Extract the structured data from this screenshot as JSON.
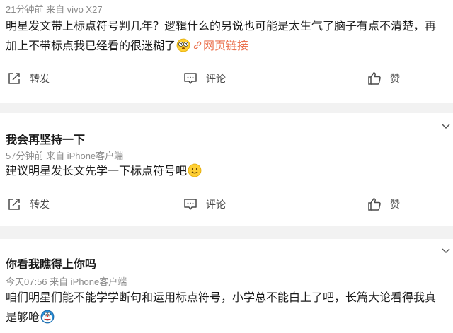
{
  "posts": [
    {
      "meta": "21分钟前  来自 vivo X27",
      "body_line1": "明星发文带上标点符号判几年？逻辑什么的另说也可能是太生气了脑子有点不清楚，再",
      "body_line2": "加上不带标点我已经看的很迷糊了",
      "link_text": "网页链接",
      "actions": {
        "repost": "转发",
        "comment": "评论",
        "like": "赞"
      }
    },
    {
      "user": "我会再坚持一下",
      "meta": "57分钟前  来自 iPhone客户端",
      "body_line1": "建议明星发长文先学一下标点符号吧",
      "actions": {
        "repost": "转发",
        "comment": "评论",
        "like": "赞"
      }
    },
    {
      "user": "你看我瞧得上你吗",
      "meta": "今天07:56  来自 iPhone客户端",
      "body_line1": "咱们明星们能不能学学断句和运用标点符号，小学总不能白上了吧，长篇大论看得我真",
      "body_line2": "是够呛"
    }
  ],
  "colors": {
    "link": "#eb7350",
    "meta": "#8a8a8a",
    "separator": "#f2f2f2"
  },
  "icons": [
    "repost-icon",
    "comment-icon",
    "like-icon",
    "dizzy-emoji",
    "smile-emoji",
    "doraemon-emoji",
    "link-icon",
    "chevron-down-icon"
  ]
}
